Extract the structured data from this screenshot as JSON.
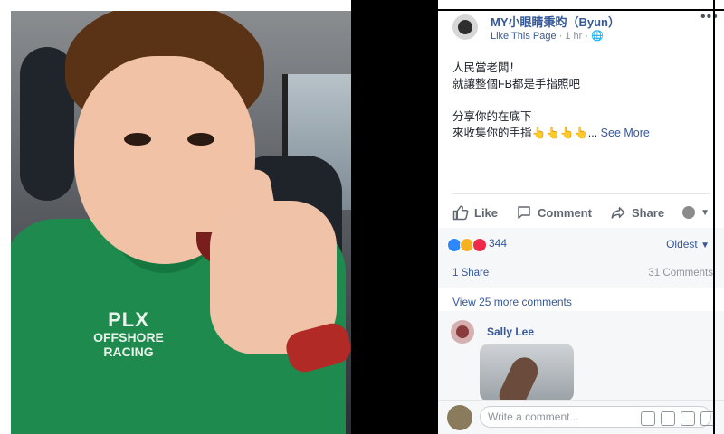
{
  "post": {
    "page_name": "MY小眼睛秉昀（Byun）",
    "like_page_label": "Like This Page",
    "time_label": "· 1 hr ·",
    "text_lines": [
      "人民當老闆！",
      "就讓整個FB都是手指照吧",
      "",
      "分享你的在底下",
      "來收集你的手指👆👆👆👆..."
    ],
    "see_more_label": "See More"
  },
  "actions": {
    "like": "Like",
    "comment": "Comment",
    "share": "Share"
  },
  "reactions": {
    "count": "344",
    "icons": [
      "like",
      "haha",
      "love"
    ],
    "colors": [
      "#2d88ff",
      "#f7b125",
      "#f0284a"
    ],
    "sort_label": "Oldest"
  },
  "shares": {
    "shares_label": "1 Share",
    "comments_label": "31 Comments"
  },
  "comments": {
    "view_more_label": "View 25 more comments",
    "items": [
      {
        "name": "Sally Lee"
      }
    ]
  },
  "composer": {
    "placeholder": "Write a comment..."
  },
  "photo": {
    "shirt_logo": "PLX",
    "shirt_logo_lines": [
      "OFFSHORE",
      "RACING"
    ]
  }
}
